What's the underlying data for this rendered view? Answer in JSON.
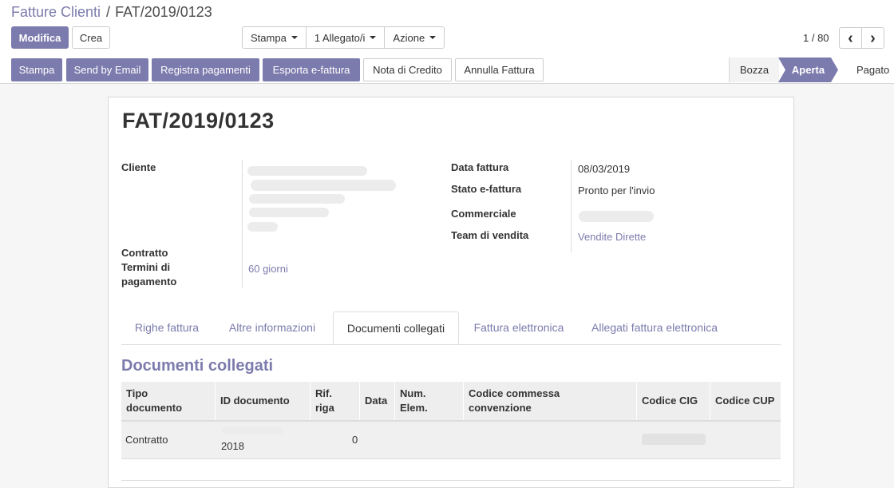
{
  "breadcrumb": {
    "parent": "Fatture Clienti",
    "separator": "/",
    "current": "FAT/2019/0123"
  },
  "control_panel": {
    "edit_label": "Modifica",
    "create_label": "Crea",
    "dropdowns": {
      "print": "Stampa",
      "attachments": "1 Allegato/i",
      "action": "Azione"
    },
    "pager": {
      "text": "1 / 80",
      "prev_glyph": "‹",
      "next_glyph": "›"
    }
  },
  "statusbar": {
    "buttons": {
      "print": "Stampa",
      "send_email": "Send by Email",
      "register_payment": "Registra pagamenti",
      "export_einvoice": "Esporta e-fattura",
      "credit_note": "Nota di Credito",
      "cancel_invoice": "Annulla Fattura"
    },
    "stages": {
      "draft": "Bozza",
      "open": "Aperta",
      "paid": "Pagato"
    },
    "active_stage": "Aperta"
  },
  "form": {
    "title": "FAT/2019/0123",
    "customer_label": "Cliente",
    "contract_label": "Contratto",
    "payment_terms_label_1": "Termini di",
    "payment_terms_label_2": "pagamento",
    "payment_terms_value": "60 giorni",
    "invoice_date_label": "Data fattura",
    "invoice_date_value": "08/03/2019",
    "einvoice_state_label": "Stato e-fattura",
    "einvoice_state_value": "Pronto per l'invio",
    "salesperson_label": "Commerciale",
    "sales_team_label": "Team di vendita",
    "sales_team_value": "Vendite Dirette"
  },
  "tabs": {
    "invoice_lines": "Righe fattura",
    "other_info": "Altre informazioni",
    "linked_docs": "Documenti collegati",
    "einvoice": "Fattura elettronica",
    "einvoice_attachments": "Allegati fattura elettronica"
  },
  "linked_docs": {
    "section_title": "Documenti collegati",
    "columns": {
      "doc_type_1": "Tipo",
      "doc_type_2": "documento",
      "doc_id": "ID documento",
      "line_ref_1": "Rif.",
      "line_ref_2": "riga",
      "date": "Data",
      "num_items_1": "Num.",
      "num_items_2": "Elem.",
      "order_code_1": "Codice commessa",
      "order_code_2": "convenzione",
      "cig": "Codice CIG",
      "cup": "Codice CUP"
    },
    "rows": [
      {
        "doc_type": "Contratto",
        "doc_id_suffix": "2018",
        "line_ref": "0"
      }
    ]
  },
  "colors": {
    "brand": "#7c7bad",
    "background": "#f6f6f6"
  }
}
